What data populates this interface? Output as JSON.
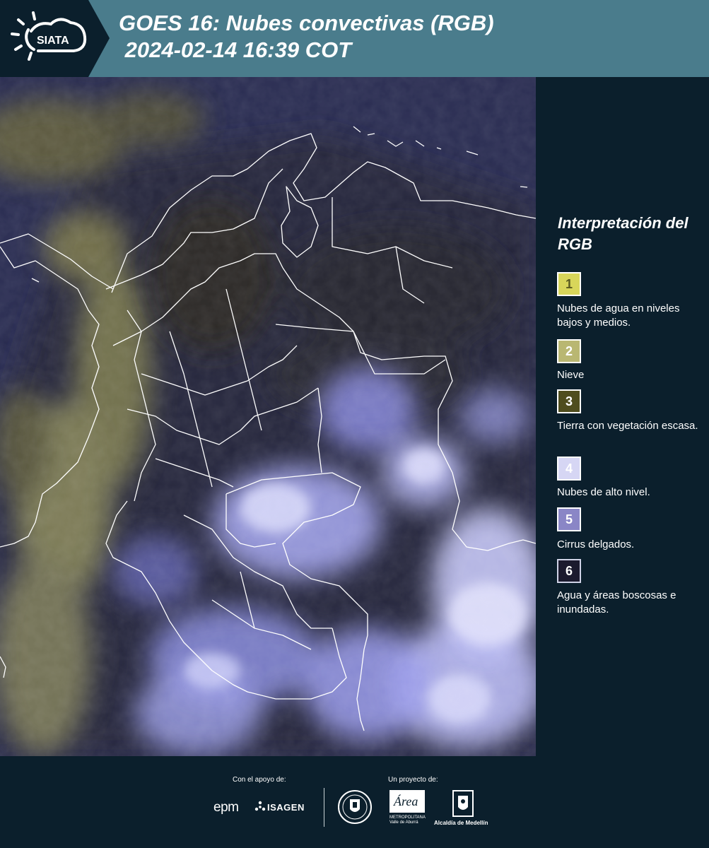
{
  "header": {
    "logo_text": "SIATA",
    "title": "GOES 16: Nubes convectivas (RGB)\n 2024-02-14 16:39 COT"
  },
  "colors": {
    "header_bg": "#4a7c8c",
    "panel_bg": "#0b1f2c",
    "borders": "#ffffff"
  },
  "legend": {
    "title": "Interpretación del RGB",
    "items": [
      {
        "number": "1",
        "color": "#d8d65a",
        "text_color": "#5a5a20",
        "label": "Nubes de agua en niveles bajos y medios."
      },
      {
        "number": "2",
        "color": "#b9b772",
        "text_color": "#ffffff",
        "label": "Nieve"
      },
      {
        "number": "3",
        "color": "#4f4d1e",
        "text_color": "#ffffff",
        "label": "Tierra con vegetación escasa."
      },
      {
        "number": "4",
        "color": "#d6d6f4",
        "text_color": "#ffffff",
        "label": "Nubes de alto nivel."
      },
      {
        "number": "5",
        "color": "#8a86c6",
        "text_color": "#ffffff",
        "label": "Cirrus delgados."
      },
      {
        "number": "6",
        "color": "#1b1a2e",
        "text_color": "#ffffff",
        "label": "Agua y áreas boscosas e inundadas."
      }
    ]
  },
  "footer": {
    "support_caption": "Con el apoyo de:",
    "project_caption": "Un proyecto de:",
    "sponsors": [
      "epm",
      "ISAGEN"
    ],
    "orgs": [
      "Área",
      "METROPOLITANA Valle de Aburrá",
      "Alcaldía de Medellín"
    ]
  }
}
